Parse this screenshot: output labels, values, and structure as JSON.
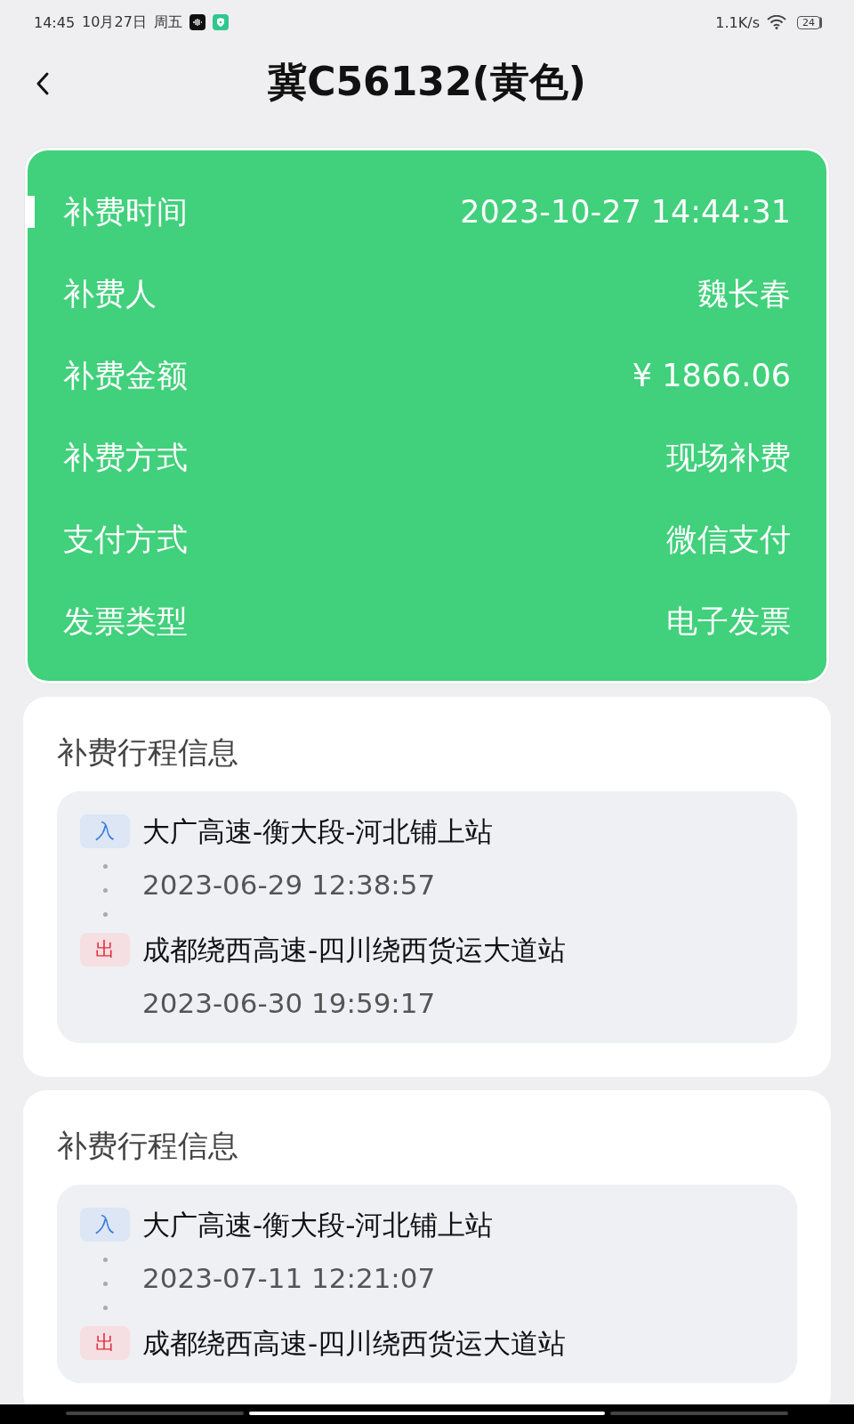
{
  "status_bar": {
    "time": "14:45",
    "date": "10月27日",
    "weekday": "周五",
    "speed": "1.1K/s",
    "battery": "24"
  },
  "header": {
    "title": "冀C56132(黄色)"
  },
  "summary": [
    {
      "label": "补费时间",
      "value": "2023-10-27 14:44:31",
      "selected": true
    },
    {
      "label": "补费人",
      "value": "魏长春",
      "selected": false
    },
    {
      "label": "补费金额",
      "value": "¥ 1866.06",
      "selected": false
    },
    {
      "label": "补费方式",
      "value": "现场补费",
      "selected": false
    },
    {
      "label": "支付方式",
      "value": "微信支付",
      "selected": false
    },
    {
      "label": "发票类型",
      "value": "电子发票",
      "selected": false
    }
  ],
  "trips": [
    {
      "title": "补费行程信息",
      "stops": [
        {
          "kind": "entry",
          "tag": "入",
          "station": "大广高速-衡大段-河北铺上站",
          "time": "2023-06-29 12:38:57"
        },
        {
          "kind": "exit",
          "tag": "出",
          "station": "成都绕西高速-四川绕西货运大道站",
          "time": "2023-06-30 19:59:17"
        }
      ]
    },
    {
      "title": "补费行程信息",
      "stops": [
        {
          "kind": "entry",
          "tag": "入",
          "station": "大广高速-衡大段-河北铺上站",
          "time": "2023-07-11 12:21:07"
        },
        {
          "kind": "exit",
          "tag": "出",
          "station": "成都绕西高速-四川绕西货运大道站"
        }
      ]
    }
  ]
}
